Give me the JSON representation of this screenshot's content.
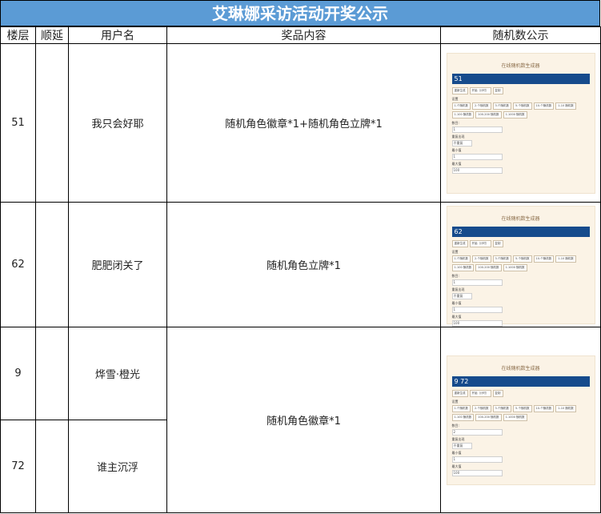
{
  "title": "艾琳娜采访活动开奖公示",
  "headers": [
    "楼层",
    "顺延",
    "用户名",
    "奖品内容",
    "随机数公示"
  ],
  "rows": [
    {
      "floor": "51",
      "defer": "",
      "user": "我只会好耶",
      "prize": "随机角色徽章*1+随机角色立牌*1"
    },
    {
      "floor": "62",
      "defer": "",
      "user": "肥肥闭关了",
      "prize": "随机角色立牌*1"
    },
    {
      "floor": "9",
      "defer": "",
      "user": "烨雪·橙光",
      "prize": "随机角色徽章*1"
    },
    {
      "floor": "72",
      "defer": "",
      "user": "谁主沉浮",
      "prize": ""
    }
  ],
  "shots": [
    {
      "title": "在线随机数生成器",
      "result": "51",
      "buttons": [
        "重新生成",
        "开始（计时）",
        "复制"
      ],
      "settings_label": "设置",
      "presets": [
        "1-个随机数",
        "2-个随机数",
        "3-个随机数",
        "5-个随机数",
        "10-个随机数",
        "1-10 随机数",
        "1-100 随机数",
        "100-200 随机数",
        "1-1000 随机数"
      ],
      "count_label": "数目:",
      "count": "1",
      "repeat_label": "重复出现",
      "repeat": "不重复",
      "min_label": "最小值",
      "min": "1",
      "max_label": "最大值",
      "max": "100"
    },
    {
      "title": "在线随机数生成器",
      "result": "62",
      "buttons": [
        "重新生成",
        "开始（计时）",
        "复制"
      ],
      "settings_label": "设置",
      "presets": [
        "1-个随机数",
        "2-个随机数",
        "3-个随机数",
        "5-个随机数",
        "10-个随机数",
        "1-10 随机数",
        "1-100 随机数",
        "100-200 随机数",
        "1-1000 随机数"
      ],
      "count_label": "数目:",
      "count": "1",
      "repeat_label": "重复出现",
      "repeat": "不重复",
      "min_label": "最小值",
      "min": "1",
      "max_label": "最大值",
      "max": "100"
    },
    {
      "title": "在线随机数生成器",
      "result": "9 72",
      "buttons": [
        "重新生成",
        "开始（计时）",
        "复制"
      ],
      "settings_label": "设置",
      "presets": [
        "1-个随机数",
        "2-个随机数",
        "3-个随机数",
        "5-个随机数",
        "10-个随机数",
        "1-10 随机数",
        "1-100 随机数",
        "100-200 随机数",
        "1-1000 随机数"
      ],
      "count_label": "数目:",
      "count": "2",
      "repeat_label": "重复出现",
      "repeat": "不重复",
      "min_label": "最小值",
      "min": "1",
      "max_label": "最大值",
      "max": "100"
    }
  ]
}
